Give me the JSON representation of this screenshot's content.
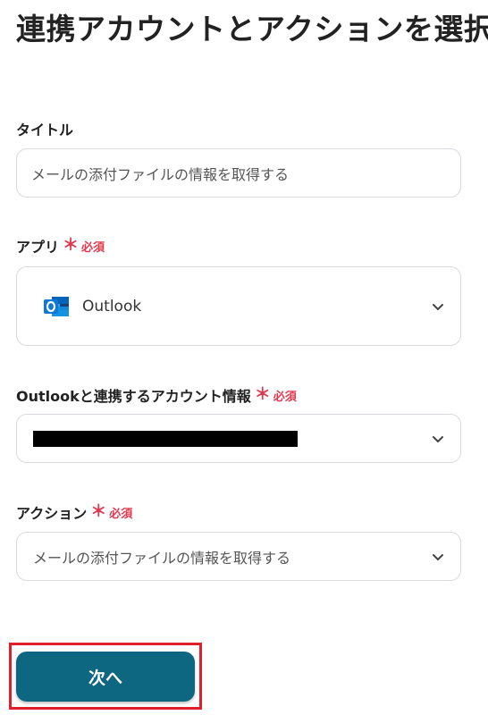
{
  "page": {
    "title": "連携アカウントとアクションを選択"
  },
  "required_mark": {
    "asterisk": "＊",
    "text": "必須",
    "color": "#e2384f"
  },
  "fields": {
    "title": {
      "label": "タイトル",
      "value": "メールの添付ファイルの情報を取得する"
    },
    "app": {
      "label": "アプリ",
      "selected_app": "Outlook",
      "icon": "outlook-icon",
      "dropdown_icon": "chevron-down-icon"
    },
    "account": {
      "label": "Outlookと連携するアカウント情報",
      "value_redacted": true,
      "dropdown_icon": "chevron-down-icon"
    },
    "action": {
      "label": "アクション",
      "selected": "メールの添付ファイルの情報を取得する",
      "dropdown_icon": "chevron-down-icon"
    }
  },
  "next_button": {
    "label": "次へ",
    "color": "#0e6781",
    "highlight_color": "#e01f2a"
  }
}
